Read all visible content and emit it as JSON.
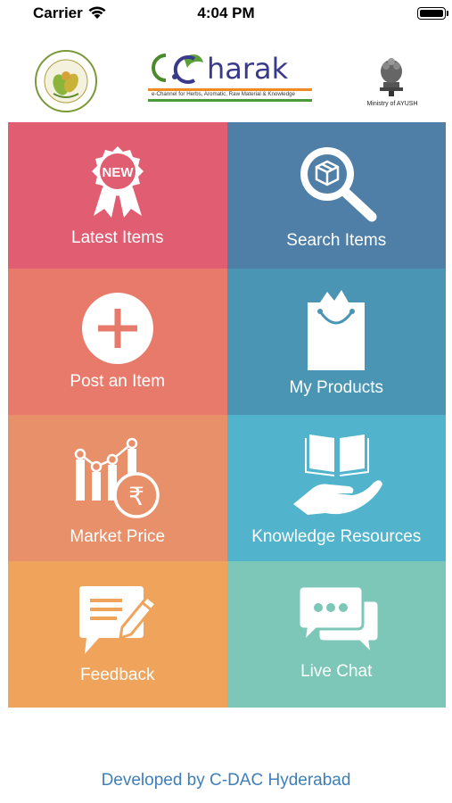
{
  "status_bar": {
    "carrier": "Carrier",
    "time": "4:04 PM"
  },
  "header": {
    "left_logo": "National Medicinal Plants Board seal",
    "center_logo_text": "C.Charak",
    "center_logo_subtitle": "e-Channel for Herbs, Aromatic, Raw Material & Knowledge",
    "right_logo_caption": "Ministry of AYUSH"
  },
  "tiles": [
    {
      "label": "Latest Items",
      "icon": "new-badge-icon",
      "color": "#e05d72"
    },
    {
      "label": "Search Items",
      "icon": "search-box-icon",
      "color": "#4f7fa6"
    },
    {
      "label": "Post an Item",
      "icon": "plus-circle-icon",
      "color": "#e77a6a"
    },
    {
      "label": "My Products",
      "icon": "shopping-bag-icon",
      "color": "#4b95b4"
    },
    {
      "label": "Market Price",
      "icon": "market-chart-rupee-icon",
      "color": "#e8906a"
    },
    {
      "label": "Knowledge Resources",
      "icon": "book-hand-icon",
      "color": "#52b3cd"
    },
    {
      "label": "Feedback",
      "icon": "feedback-pen-icon",
      "color": "#f0a35a"
    },
    {
      "label": "Live Chat",
      "icon": "chat-bubbles-icon",
      "color": "#7cc7b8"
    }
  ],
  "footer": {
    "text": "Developed by C-DAC Hyderabad"
  }
}
